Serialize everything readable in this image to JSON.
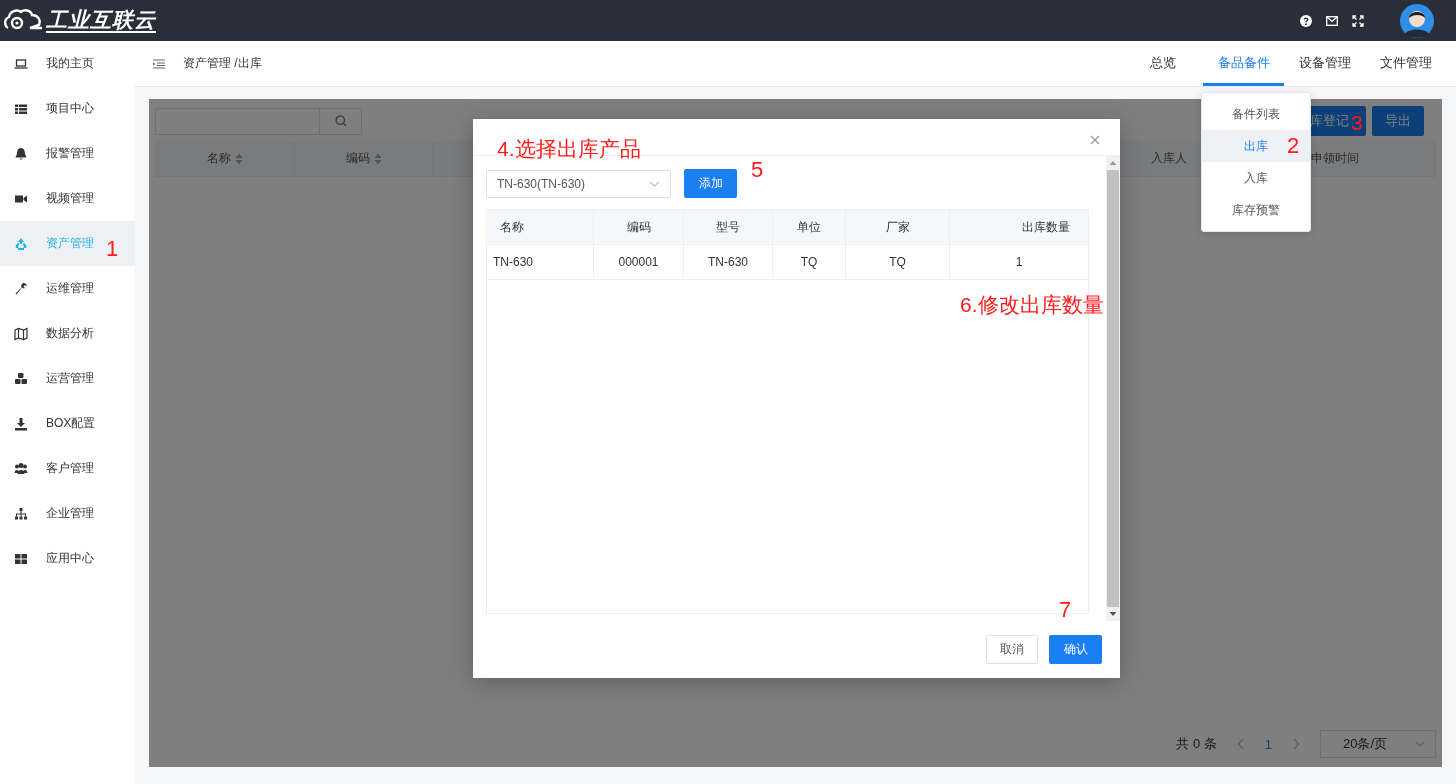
{
  "topbar": {
    "logo_text": "工业互联云"
  },
  "sidebar": {
    "items": [
      {
        "label": "我的主页",
        "selected": false
      },
      {
        "label": "项目中心",
        "selected": false
      },
      {
        "label": "报警管理",
        "selected": false
      },
      {
        "label": "视频管理",
        "selected": false
      },
      {
        "label": "资产管理",
        "selected": true
      },
      {
        "label": "运维管理",
        "selected": false
      },
      {
        "label": "数据分析",
        "selected": false
      },
      {
        "label": "运营管理",
        "selected": false
      },
      {
        "label": "BOX配置",
        "selected": false
      },
      {
        "label": "客户管理",
        "selected": false
      },
      {
        "label": "企业管理",
        "selected": false
      },
      {
        "label": "应用中心",
        "selected": false
      }
    ]
  },
  "header": {
    "breadcrumb": "资产管理 /出库",
    "tabs": [
      {
        "label": "总览",
        "selected": false
      },
      {
        "label": "备品备件",
        "selected": true
      },
      {
        "label": "设备管理",
        "selected": false
      },
      {
        "label": "文件管理",
        "selected": false
      }
    ]
  },
  "dropdown_menu": {
    "items": [
      {
        "label": "备件列表",
        "selected": false
      },
      {
        "label": "出库",
        "selected": true
      },
      {
        "label": "入库",
        "selected": false
      },
      {
        "label": "库存预警",
        "selected": false
      }
    ]
  },
  "panel": {
    "buttons": [
      "库登记",
      "导出"
    ],
    "columns": [
      {
        "label": "名称",
        "sortable": true
      },
      {
        "label": "编码",
        "sortable": true
      },
      {
        "label": "入库人",
        "sortable": false
      },
      {
        "label": "申领时间",
        "sortable": false
      }
    ],
    "pagination": {
      "total": "共 0 条",
      "page": "1",
      "page_size": "20条/页"
    }
  },
  "modal": {
    "select_value": "TN-630(TN-630)",
    "add_button": "添加",
    "columns": [
      "名称",
      "编码",
      "型号",
      "单位",
      "厂家",
      "出库数量"
    ],
    "rows": [
      [
        "TN-630",
        "000001",
        "TN-630",
        "TQ",
        "TQ",
        "1"
      ]
    ],
    "cancel_button": "取消",
    "confirm_button": "确认"
  },
  "annotations": [
    {
      "text": "1"
    },
    {
      "text": "2"
    },
    {
      "text": "3"
    },
    {
      "text": "4.选择出库产品"
    },
    {
      "text": "5"
    },
    {
      "text": "6.修改出库数量"
    },
    {
      "text": "7"
    }
  ]
}
